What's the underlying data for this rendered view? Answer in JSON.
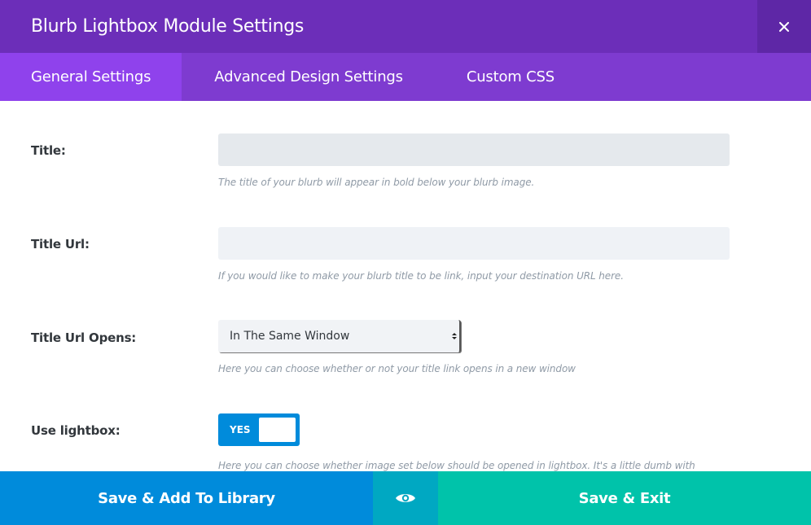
{
  "header": {
    "title": "Blurb Lightbox Module Settings",
    "close_icon": "close-icon"
  },
  "tabs": [
    {
      "label": "General Settings",
      "active": true
    },
    {
      "label": "Advanced Design Settings",
      "active": false
    },
    {
      "label": "Custom CSS",
      "active": false
    }
  ],
  "fields": {
    "title": {
      "label": "Title:",
      "value": "",
      "help": "The title of your blurb will appear in bold below your blurb image."
    },
    "title_url": {
      "label": "Title Url:",
      "value": "",
      "help": "If you would like to make your blurb title to be link, input your destination URL here."
    },
    "title_url_opens": {
      "label": "Title Url Opens:",
      "selected": "In The Same Window",
      "help": "Here you can choose whether or not your title link opens in a new window"
    },
    "use_lightbox": {
      "label": "Use lightbox:",
      "toggle_label": "YES",
      "enabled": true,
      "help": "Here you can choose whether image set below should be opened in lightbox. It's a little dumb with"
    }
  },
  "footer": {
    "save_library_label": "Save & Add To Library",
    "preview_icon": "eye-icon",
    "save_exit_label": "Save & Exit"
  },
  "colors": {
    "header_bg": "#6c2eb9",
    "tabs_bg": "#7e3bd0",
    "active_tab_bg": "#8f42ec",
    "library_button": "#008bdb",
    "preview_button": "#00a8c2",
    "exit_button": "#00c3aa",
    "toggle_on": "#008bdb"
  }
}
